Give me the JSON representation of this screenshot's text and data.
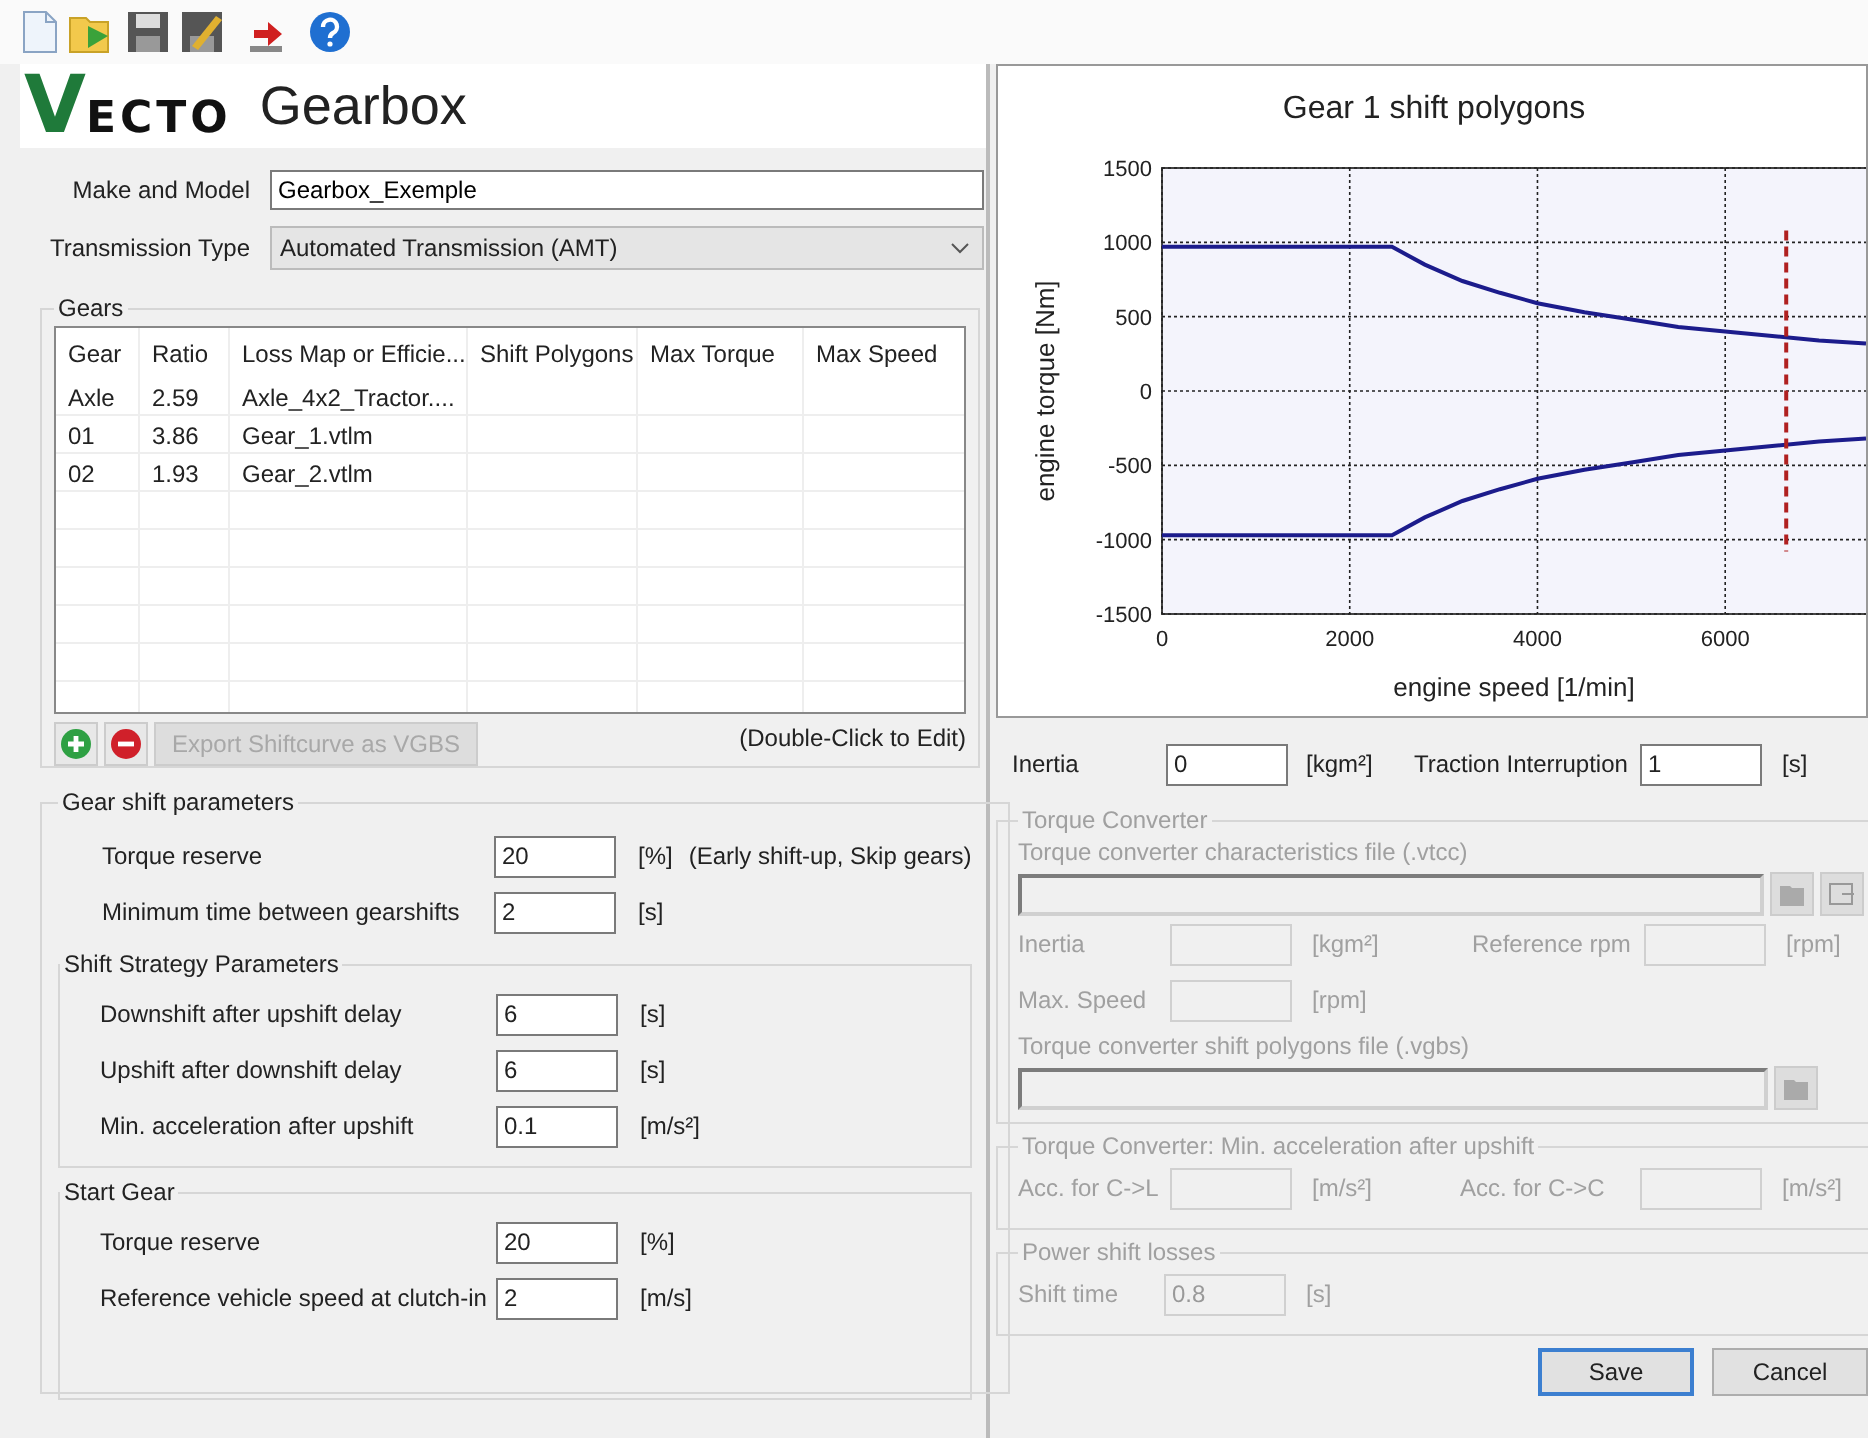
{
  "toolbar": {
    "buttons": [
      {
        "kind": "new"
      },
      {
        "kind": "open"
      },
      {
        "kind": "save"
      },
      {
        "kind": "save_as"
      },
      {
        "kind": "export"
      },
      {
        "kind": "help"
      }
    ]
  },
  "header": {
    "logo_initial": "V",
    "logo_rest": "ECTO",
    "title": "Gearbox"
  },
  "make_and_model": {
    "label": "Make and Model",
    "value": "Gearbox_Exemple"
  },
  "transmission_type": {
    "label": "Transmission Type",
    "value": "Automated Transmission (AMT)"
  },
  "gears": {
    "title": "Gears",
    "columns": [
      "Gear",
      "Ratio",
      "Loss Map or Efficie...",
      "Shift Polygons",
      "Max Torque",
      "Max Speed"
    ],
    "rows": [
      {
        "gear": "Axle",
        "ratio": "2.59",
        "loss_map": "Axle_4x2_Tractor...."
      },
      {
        "gear": "01",
        "ratio": "3.86",
        "loss_map": "Gear_1.vtlm"
      },
      {
        "gear": "02",
        "ratio": "1.93",
        "loss_map": "Gear_2.vtlm"
      }
    ],
    "export_button": {
      "label": "Export Shiftcurve as VGBS",
      "disabled": true
    },
    "hint": "(Double-Click to Edit)"
  },
  "gear_shift_parameters": {
    "title": "Gear shift parameters",
    "rows": [
      {
        "label": "Torque reserve",
        "value": "20",
        "unit": "[%]",
        "note": "(Early shift-up, Skip gears)"
      },
      {
        "label": "Minimum time between gearshifts",
        "value": "2",
        "unit": "[s]"
      }
    ],
    "groups": [
      {
        "title": "Shift Strategy Parameters",
        "rows": [
          {
            "label": "Downshift after upshift delay",
            "value": "6",
            "unit": "[s]"
          },
          {
            "label": "Upshift after downshift delay",
            "value": "6",
            "unit": "[s]"
          },
          {
            "label": "Min. acceleration after upshift",
            "value": "0.1",
            "unit": "[m/s²]"
          }
        ]
      },
      {
        "title": "Start Gear",
        "rows": [
          {
            "label": "Torque reserve",
            "value": "20",
            "unit": "[%]"
          },
          {
            "label": "Reference vehicle speed at clutch-in",
            "value": "2",
            "unit": "[m/s]"
          }
        ]
      }
    ]
  },
  "chart": {
    "chart_data": {
      "type": "line",
      "title": "Gear 1 shift polygons",
      "xlabel": "engine speed [1/min]",
      "ylabel": "engine torque [Nm]",
      "x": [
        0,
        2450,
        2800,
        3200,
        3600,
        4000,
        4500,
        5000,
        5500,
        6000,
        6500,
        7000,
        7500
      ],
      "series": [
        {
          "color": "#1c1c8c",
          "values": [
            970,
            970,
            850,
            740,
            660,
            590,
            530,
            480,
            430,
            400,
            370,
            340,
            320
          ]
        },
        {
          "color": "#1c1c8c",
          "values": [
            -970,
            -970,
            -850,
            -740,
            -660,
            -590,
            -530,
            -480,
            -430,
            -400,
            -370,
            -340,
            -320
          ]
        }
      ],
      "xlim": [
        0,
        7500
      ],
      "ylim": [
        -1500,
        1500
      ],
      "xticks": [
        0,
        2000,
        4000,
        6000
      ],
      "yticks": [
        -1500,
        -1000,
        -500,
        0,
        500,
        1000,
        1500
      ],
      "grid": true,
      "ref_lines": [
        {
          "axis": "x",
          "value": 6650,
          "color": "#b02020"
        }
      ]
    }
  },
  "inertia": {
    "label": "Inertia",
    "value": "0",
    "unit": "[kgm²]"
  },
  "traction_interruption": {
    "label": "Traction Interruption",
    "value": "1",
    "unit": "[s]"
  },
  "torque_converter": {
    "title": "Torque Converter",
    "disabled": true,
    "file_label": "Torque converter characteristics file (.vtcc)",
    "inertia": {
      "label": "Inertia",
      "unit": "[kgm²]"
    },
    "reference_rpm": {
      "label": "Reference rpm",
      "unit": "[rpm]"
    },
    "max_speed": {
      "label": "Max. Speed",
      "unit": "[rpm]"
    },
    "shift_file_label": "Torque converter shift polygons file (.vgbs)"
  },
  "tc_min_acceleration": {
    "title": "Torque Converter: Min. acceleration after upshift",
    "disabled": true,
    "fields": [
      {
        "label": "Acc. for C->L",
        "unit": "[m/s²]"
      },
      {
        "label": "Acc. for C->C",
        "unit": "[m/s²]"
      }
    ]
  },
  "power_shift_losses": {
    "title": "Power shift losses",
    "disabled": true,
    "label": "Shift time",
    "value": "0.8",
    "unit": "[s]"
  },
  "buttons": [
    {
      "label": "Save",
      "default": true
    },
    {
      "label": "Cancel",
      "default": false
    }
  ]
}
